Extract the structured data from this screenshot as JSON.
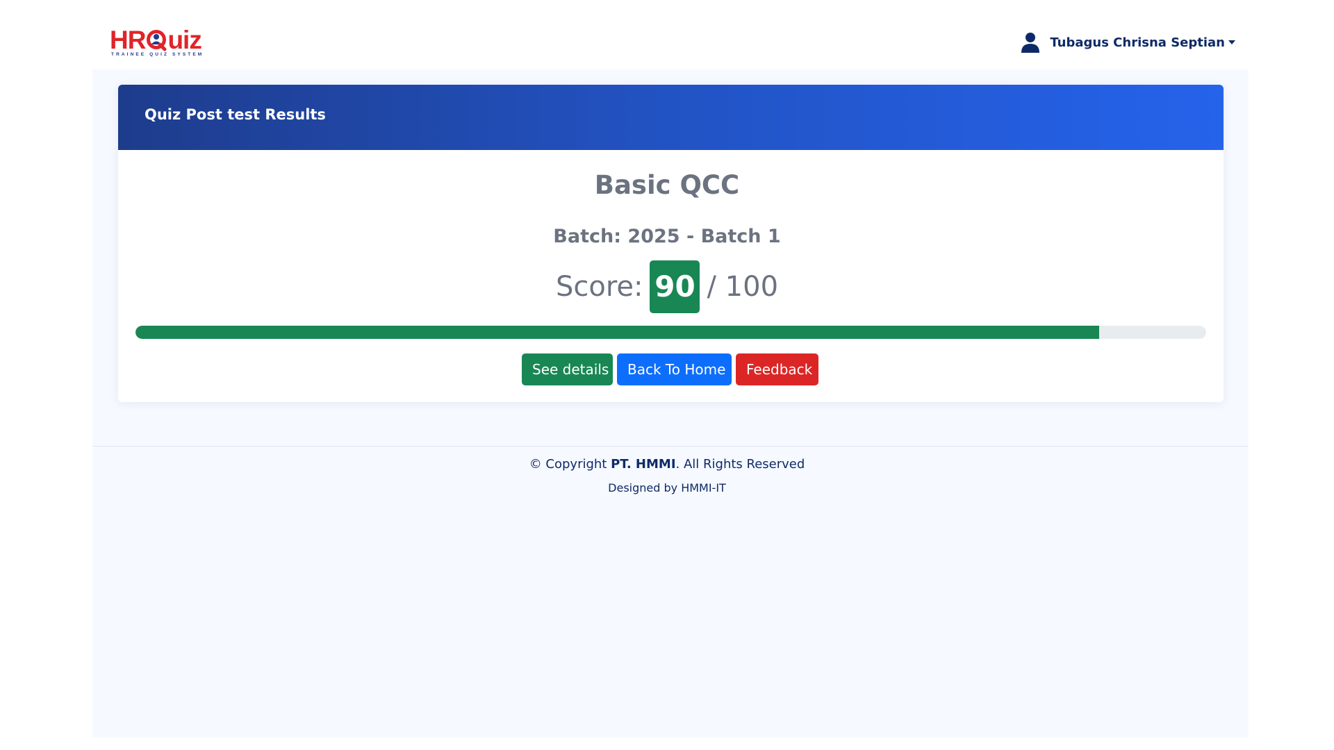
{
  "header": {
    "logo": {
      "part1": "HR",
      "part2": "uiz",
      "tagline": "TRAINEE QUIZ SYSTEM"
    },
    "user": {
      "name": "Tubagus Chrisna Septian",
      "icon": "person-icon"
    }
  },
  "card": {
    "title": "Quiz Post test Results",
    "quiz_name": "Basic QCC",
    "batch": "Batch: 2025 - Batch 1",
    "score_label": "Score:",
    "score_value": "90",
    "score_total": "/ 100",
    "progress_fraction": 0.9,
    "buttons": {
      "details": "See details",
      "home": "Back To Home",
      "feedback": "Feedback"
    }
  },
  "footer": {
    "copyright_prefix": "© Copyright ",
    "company": "PT. HMMI",
    "copyright_suffix": ". All Rights Reserved",
    "designed_by": "Designed by HMMI-IT"
  },
  "colors": {
    "success": "#198754",
    "primary": "#0d6efd",
    "danger": "#dc2626",
    "brand_red": "#e0242a",
    "navy": "#0e2a66"
  }
}
